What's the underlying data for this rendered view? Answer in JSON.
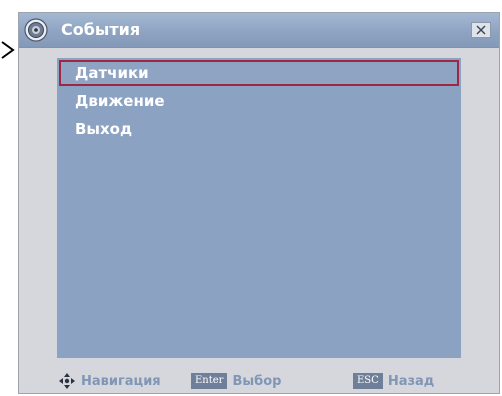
{
  "window": {
    "title": "События",
    "icons": {
      "app": "webcam-icon",
      "close": "close-icon"
    }
  },
  "menu": {
    "items": [
      {
        "label": "Датчики",
        "selected": true
      },
      {
        "label": "Движение",
        "selected": false
      },
      {
        "label": "Выход",
        "selected": false
      }
    ]
  },
  "footer": {
    "navigation": {
      "icon": "navigation-arrows-icon",
      "label": "Навигация"
    },
    "select": {
      "key": "Enter",
      "label": "Выбор"
    },
    "back": {
      "key": "ESC",
      "label": "Назад"
    }
  },
  "colors": {
    "titlebar": "#8ea4c2",
    "content": "#8ca2c2",
    "selection_border": "#9c2846",
    "text": "#ffffff",
    "footer_text": "#8096b6"
  }
}
